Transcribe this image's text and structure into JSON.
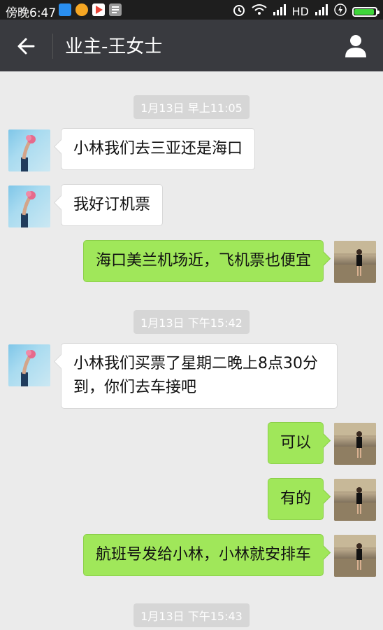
{
  "status_bar": {
    "time": "傍晚6:47",
    "network": "HD",
    "app_icons": [
      "app-notification-icon",
      "weibo-icon",
      "play-store-icon",
      "document-icon"
    ],
    "battery_level": 0.95,
    "colors": {
      "background": "#1e1e1e",
      "battery": "#3ed53a"
    }
  },
  "header": {
    "title": "业主-王女士",
    "back_icon": "back-arrow-icon",
    "profile_icon": "profile-icon"
  },
  "colors": {
    "navbar": "#393a3f",
    "chat_background": "#ebebeb",
    "sent_bubble": "#a0e75a",
    "received_bubble": "#ffffff"
  },
  "messages": [
    {
      "type": "timestamp",
      "text": "1月13日 早上11:05"
    },
    {
      "type": "received",
      "text": "小林我们去三亚还是海口"
    },
    {
      "type": "received",
      "text": "我好订机票"
    },
    {
      "type": "sent",
      "text": "海口美兰机场近，飞机票也便宜"
    },
    {
      "type": "timestamp",
      "text": "1月13日 下午15:42"
    },
    {
      "type": "received",
      "text": "小林我们买票了星期二晚上8点30分到，你们去车接吧"
    },
    {
      "type": "sent",
      "text": "可以"
    },
    {
      "type": "sent",
      "text": "有的"
    },
    {
      "type": "sent",
      "text": "航班号发给小林，小林就安排车"
    },
    {
      "type": "timestamp",
      "text": "1月13日 下午15:43"
    }
  ]
}
